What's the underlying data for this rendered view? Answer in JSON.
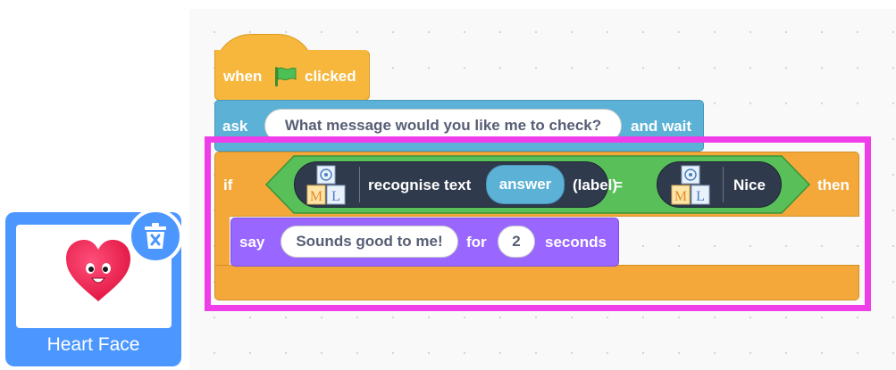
{
  "blocks": {
    "hat": {
      "when": "when",
      "clicked": "clicked"
    },
    "ask": {
      "label": "ask",
      "question": "What message would you like me to check?",
      "suffix": "and wait"
    },
    "if_block": {
      "if": "if",
      "then": "then"
    },
    "compare": {
      "left": {
        "text": "recognise text",
        "input": "answer",
        "suffix": "(label)"
      },
      "operator": "=",
      "right": {
        "text": "Nice"
      },
      "ml_icon_letters": [
        "M",
        "L"
      ]
    },
    "say": {
      "label": "say",
      "message": "Sounds good to me!",
      "for": "for",
      "seconds_value": "2",
      "seconds": "seconds"
    }
  },
  "sprite": {
    "name": "Heart Face",
    "icon": "heart-face-icon",
    "delete_icon": "trash-icon"
  },
  "colors": {
    "events": "#f6b73c",
    "sensing": "#5cb1d6",
    "control": "#f4a83a",
    "operators": "#59c059",
    "looks": "#9966ff",
    "ml": "#2f3a4c",
    "highlight": "#ee3de9",
    "sprite_selected": "#4c97ff"
  }
}
